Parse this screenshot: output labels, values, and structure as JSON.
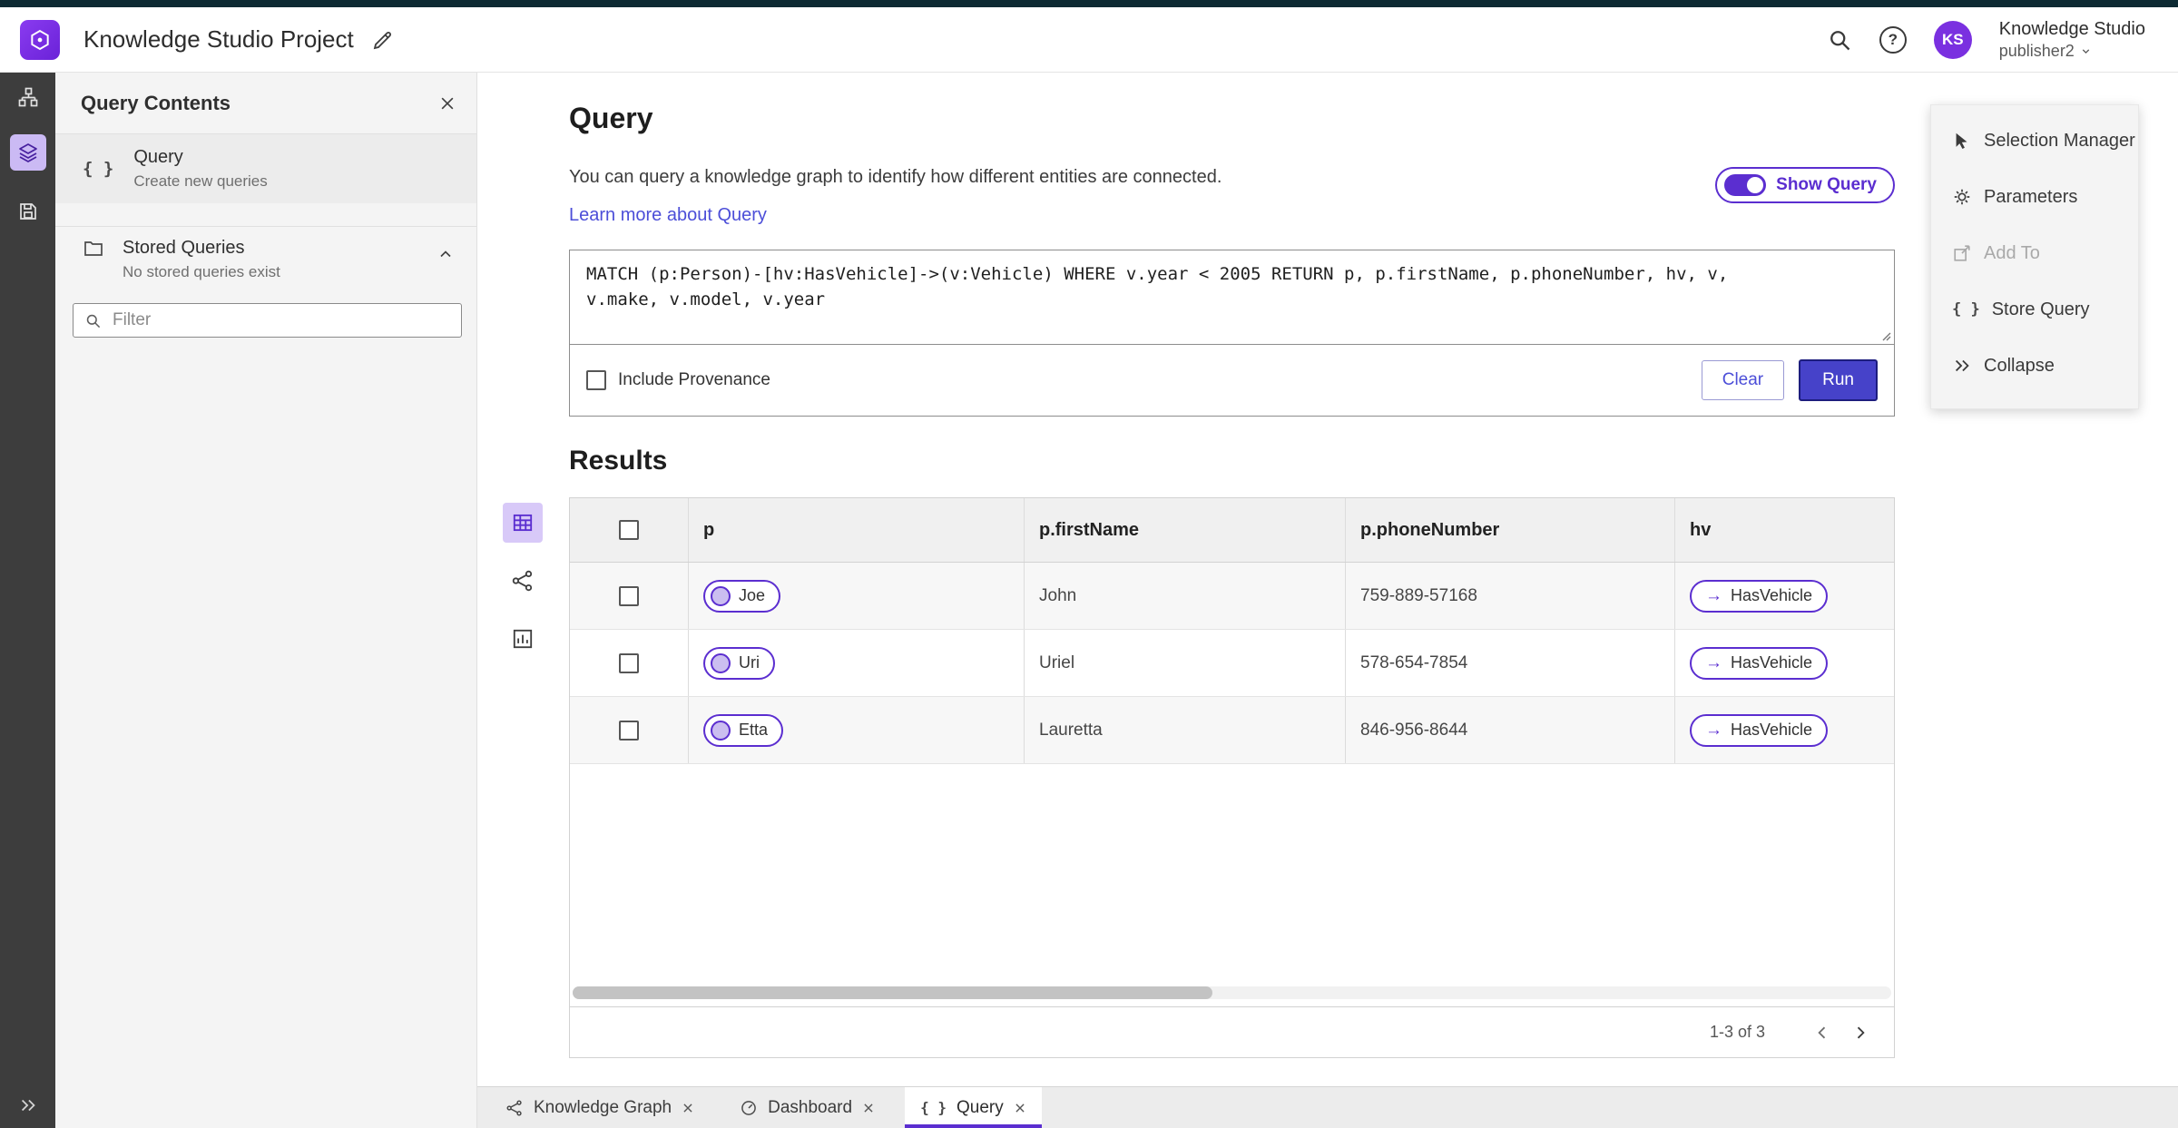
{
  "header": {
    "title": "Knowledge Studio Project",
    "help_glyph": "?",
    "user_initials": "KS",
    "user_name": "Knowledge Studio",
    "user_role": "publisher2"
  },
  "left_panel": {
    "title": "Query Contents",
    "query_item": {
      "label": "Query",
      "sublabel": "Create new queries"
    },
    "stored": {
      "label": "Stored Queries",
      "sublabel": "No stored queries exist"
    },
    "filter_placeholder": "Filter"
  },
  "query": {
    "heading": "Query",
    "description": "You can query a knowledge graph to identify how different entities are connected.",
    "learn_more": "Learn more about Query",
    "show_query": "Show Query",
    "text": "MATCH (p:Person)-[hv:HasVehicle]->(v:Vehicle) WHERE v.year < 2005 RETURN p, p.firstName, p.phoneNumber, hv, v, v.make, v.model, v.year",
    "include_provenance": "Include Provenance",
    "clear": "Clear",
    "run": "Run"
  },
  "results": {
    "heading": "Results",
    "columns": [
      "p",
      "p.firstName",
      "p.phoneNumber",
      "hv"
    ],
    "rows": [
      {
        "p": "Joe",
        "firstName": "John",
        "phone": "759-889-57168",
        "hv": "HasVehicle"
      },
      {
        "p": "Uri",
        "firstName": "Uriel",
        "phone": "578-654-7854",
        "hv": "HasVehicle"
      },
      {
        "p": "Etta",
        "firstName": "Lauretta",
        "phone": "846-956-8644",
        "hv": "HasVehicle"
      }
    ],
    "edge_arrow": "→",
    "pagination": "1-3 of 3"
  },
  "right_panel": {
    "items": [
      {
        "label": "Selection Manager",
        "disabled": false
      },
      {
        "label": "Parameters",
        "disabled": false
      },
      {
        "label": "Add To",
        "disabled": true
      },
      {
        "label": "Store Query",
        "disabled": false
      },
      {
        "label": "Collapse",
        "disabled": false
      }
    ]
  },
  "tabs": [
    {
      "label": "Knowledge Graph",
      "active": false
    },
    {
      "label": "Dashboard",
      "active": false
    },
    {
      "label": "Query",
      "active": true
    }
  ],
  "glyphs": {
    "braces": "{ }"
  },
  "colors": {
    "accent_purple": "#5b2ed0",
    "brand_purple": "#7b2fe0",
    "run_button": "#4642c9",
    "link_indigo": "#4c4ed8",
    "rail_dark": "#3d3d3d",
    "top_strip": "#0d2a33",
    "panel_gray": "#f4f4f4"
  },
  "icons": [
    "search-icon",
    "help-icon",
    "edit-icon",
    "close-icon",
    "braces-icon",
    "folder-icon",
    "chevron-up-icon",
    "tree-icon",
    "layers-icon",
    "save-icon",
    "expand-icon",
    "table-view-icon",
    "graph-view-icon",
    "chart-view-icon",
    "selection-manager-icon",
    "parameters-icon",
    "add-to-icon",
    "store-query-icon",
    "collapse-icon",
    "chevron-left-icon",
    "chevron-right-icon",
    "knowledge-graph-icon",
    "dashboard-icon"
  ]
}
